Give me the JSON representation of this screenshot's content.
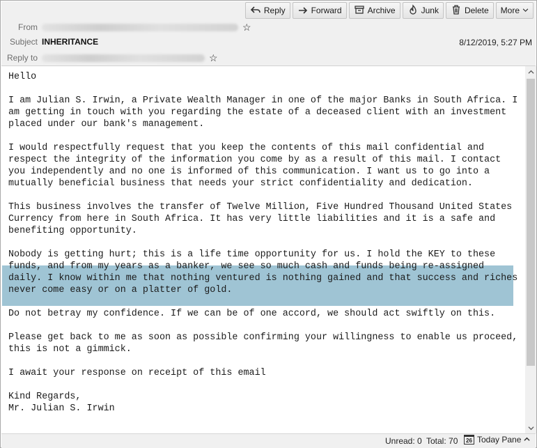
{
  "toolbar": {
    "reply": "Reply",
    "forward": "Forward",
    "archive": "Archive",
    "junk": "Junk",
    "delete": "Delete",
    "more": "More"
  },
  "header": {
    "from_label": "From",
    "subject_label": "Subject",
    "subject": "INHERITANCE",
    "reply_to_label": "Reply to",
    "date": "8/12/2019, 5:27 PM"
  },
  "message": {
    "greeting": "Hello",
    "p1": [
      "I am Julian S. Irwin, a Private Wealth Manager in one of the major Banks in South Africa. I",
      "am getting in touch with you regarding the estate of a deceased client with an investment",
      "placed under our bank's management."
    ],
    "p2": [
      "I would respectfully request that you keep the contents of this mail confidential and",
      "respect the integrity of the information you come by as a result of this mail. I contact",
      "you independently and no one is informed of this communication. I want us to go into a",
      "mutually beneficial business that needs your strict confidentiality and dedication."
    ],
    "p3": [
      "This business involves the transfer of Twelve Million, Five Hundred Thousand United States",
      "Currency from here in South Africa. It has very little liabilities and it is a safe and",
      "benefiting opportunity."
    ],
    "p4": [
      "Nobody is getting hurt; this is a life time opportunity for us. I hold the KEY to these",
      "funds, and from my years as a banker, we see so much cash and funds being re-assigned",
      "daily. I know within me that nothing ventured is nothing gained and that success and riches",
      "never come easy or on a platter of gold."
    ],
    "p5": [
      "Do not betray my confidence. If we can be of one accord, we should act swiftly on this."
    ],
    "p6": [
      "Please get back to me as soon as possible confirming your willingness to enable us proceed,",
      "this is not a gimmick."
    ],
    "p7": [
      "I await your response on receipt of this email"
    ],
    "closing": [
      "Kind Regards,",
      "Mr. Julian S. Irwin"
    ]
  },
  "status": {
    "unread": "Unread: 0",
    "total": "Total: 70",
    "calendar_day": "26",
    "today_pane": "Today Pane"
  }
}
